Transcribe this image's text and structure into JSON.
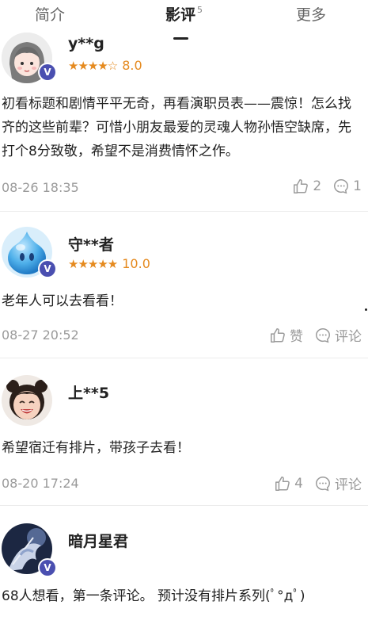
{
  "tabs": [
    {
      "label": "简介"
    },
    {
      "label": "影评",
      "count": "5"
    },
    {
      "label": "更多"
    }
  ],
  "reviews": [
    {
      "user": "y**g",
      "stars": "★★★★☆",
      "score": "8.0",
      "content": "初看标题和剧情平平无奇，再看演职员表——震惊！怎么找齐的这些前辈？可惜小朋友最爱的灵魂人物孙悟空缺席，先打个8分致敬，希望不是消费情怀之作。",
      "date": "08-26 18:35",
      "likes": "2",
      "comments": "1"
    },
    {
      "user": "守**者",
      "stars": "★★★★★",
      "score": "10.0",
      "content": "老年人可以去看看！",
      "date": "08-27 20:52",
      "likes": "赞",
      "comments": "评论"
    },
    {
      "user": "上**5",
      "content": "希望宿迁有排片，带孩子去看！",
      "date": "08-20 17:24",
      "likes": "4",
      "comments": "评论"
    },
    {
      "user": "暗月星君",
      "content": "68人想看，第一条评论。 预计没有排片系列(ﾟ°дﾟ)"
    }
  ],
  "colors": {
    "accent": "#e58a1f",
    "vip_badge": "#4a4fb0",
    "muted": "#9a9a9a"
  }
}
